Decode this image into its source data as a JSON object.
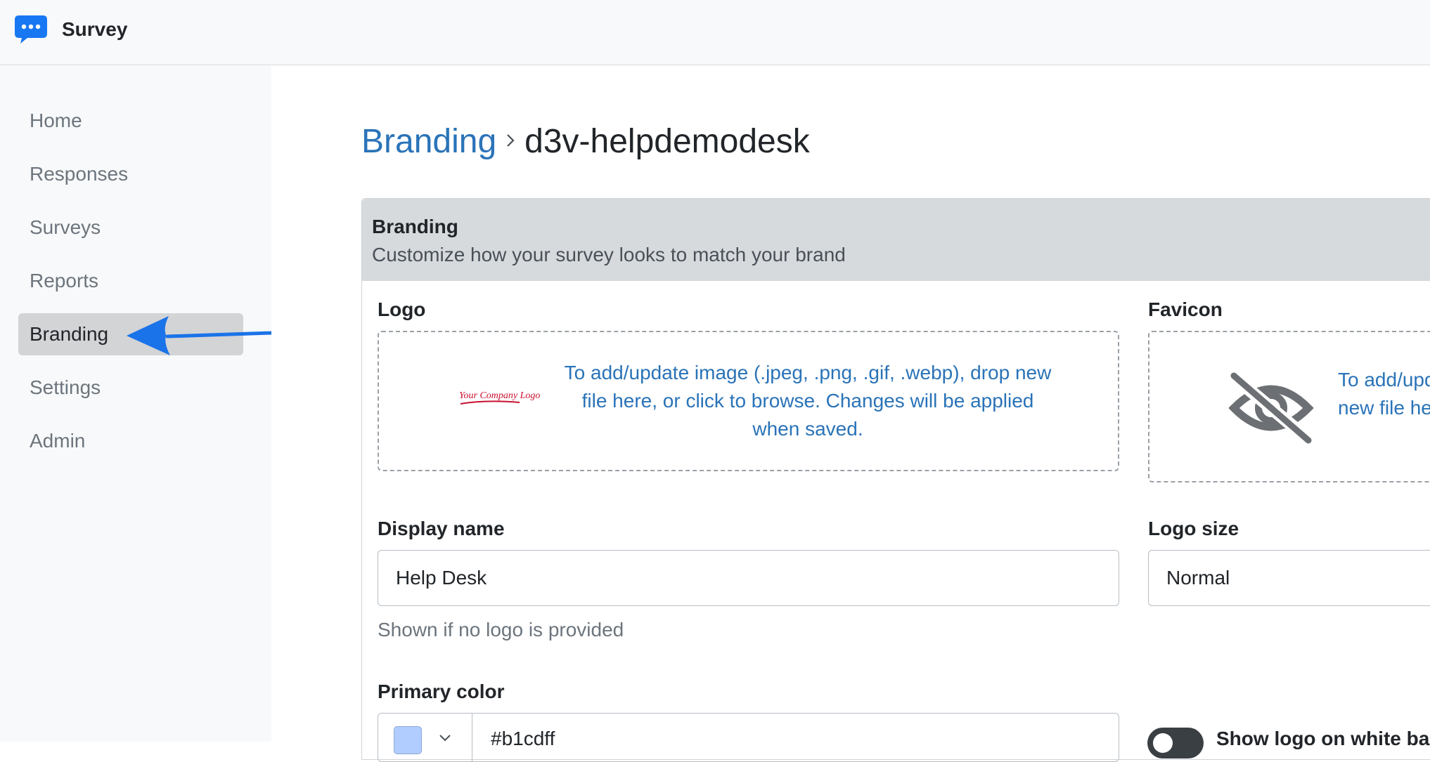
{
  "app": {
    "title": "Survey",
    "logo_icon": "chat-bubble-icon",
    "accent_color": "#2a73b8",
    "logo_color": "#1877f2"
  },
  "sidebar": {
    "items": [
      {
        "label": "Home",
        "active": false
      },
      {
        "label": "Responses",
        "active": false
      },
      {
        "label": "Surveys",
        "active": false
      },
      {
        "label": "Reports",
        "active": false
      },
      {
        "label": "Branding",
        "active": true
      },
      {
        "label": "Settings",
        "active": false
      },
      {
        "label": "Admin",
        "active": false
      }
    ]
  },
  "annotation": {
    "arrow_icon": "left-arrow-icon",
    "arrow_color": "#1a73e8"
  },
  "breadcrumb": {
    "parent": "Branding",
    "separator_icon": "chevron-right-icon",
    "current": "d3v-helpdemodesk"
  },
  "card": {
    "title": "Branding",
    "subtitle": "Customize how your survey looks to match your brand"
  },
  "logo": {
    "label": "Logo",
    "image_text": "Your Company Logo",
    "dropzone_text": "To add/update image (.jpeg, .png, .gif, .webp), drop new file here, or click to browse. Changes will be applied when saved."
  },
  "favicon": {
    "label": "Favicon",
    "icon": "eye-slash-icon",
    "dropzone_text": "To add/upd\nnew file he"
  },
  "display_name": {
    "label": "Display name",
    "value": "Help Desk",
    "help": "Shown if no logo is provided"
  },
  "logo_size": {
    "label": "Logo size",
    "value": "Normal"
  },
  "primary_color": {
    "label": "Primary color",
    "value": "#b1cdff",
    "swatch_color": "#b1cdff"
  },
  "white_background": {
    "label": "Show logo on white ba",
    "enabled": false
  }
}
